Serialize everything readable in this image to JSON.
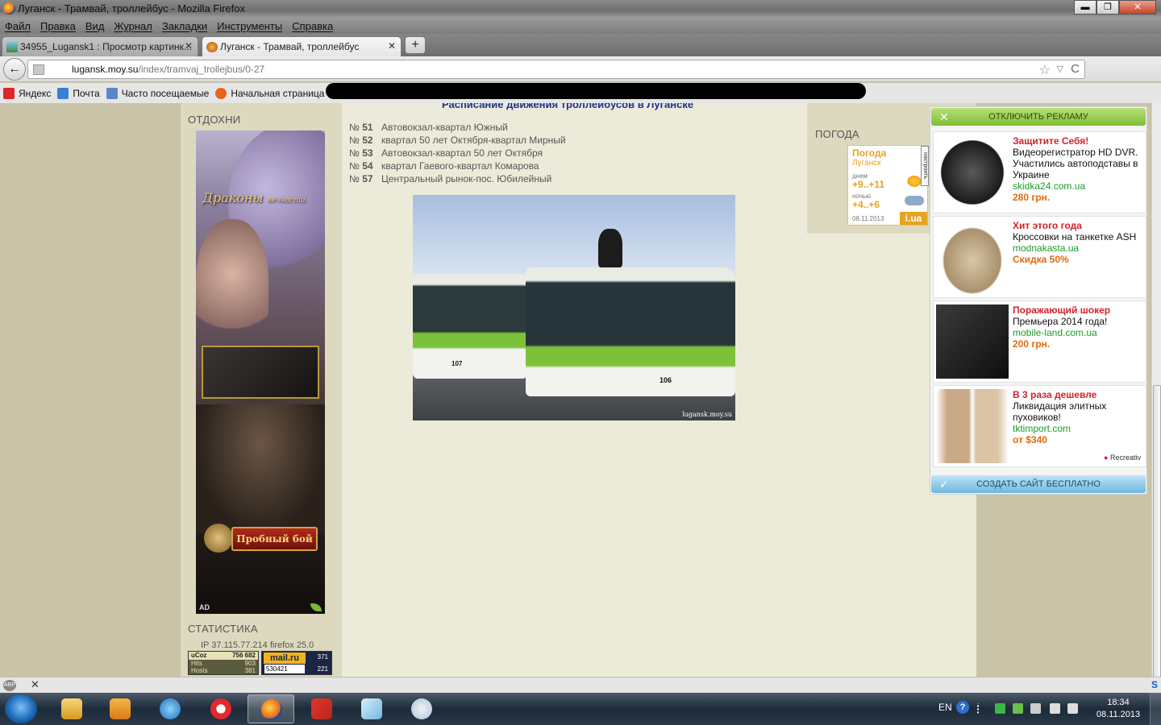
{
  "window": {
    "title": "Луганск - Трамвай, троллейбус - Mozilla Firefox",
    "btn_min": "▬",
    "btn_max": "❐",
    "btn_close": "✕"
  },
  "menu": [
    "Файл",
    "Правка",
    "Вид",
    "Журнал",
    "Закладки",
    "Инструменты",
    "Справка"
  ],
  "tabs": [
    {
      "label": "34955_Lugansk1 : Просмотр картинк...",
      "close": "✕"
    },
    {
      "label": "Луганск - Трамвай, троллейбус",
      "close": "✕"
    }
  ],
  "newtab_label": "+",
  "navbar": {
    "back": "←",
    "url_host": "lugansk.moy.su",
    "url_path": "/index/tramvaj_trollejbus/0-27",
    "star": "☆",
    "dropdown": "▽",
    "reload": "C",
    "download": "⬇",
    "ext": "S"
  },
  "bookmarks": [
    {
      "label": "Яндекс",
      "color": "#e0242a"
    },
    {
      "label": "Почта",
      "color": "#3a7fd3"
    },
    {
      "label": "Часто посещаемые",
      "color": "#5a86c8"
    },
    {
      "label": "Начальная страница",
      "color": "#e5651b"
    }
  ],
  "page": {
    "partial_title": "Расписание движения троллейбусов в Луганске",
    "left": {
      "section_relax": "ОТДОХНИ",
      "banner": {
        "logo": "Драконы",
        "logo_sub": "вечности",
        "try_button": "Пробный бой",
        "ad_mark": "AD"
      },
      "section_stats": "СТАТИСТИКА",
      "stats_ip": "IP 37.115.77.214 firefox 25.0",
      "counter1": {
        "top_left": "uCoz",
        "top_right": "756 682",
        "hits_label": "Hits",
        "hits": "903",
        "hosts_label": "Hosts",
        "hosts": "381"
      },
      "counter2": {
        "brand": "mail.ru",
        "v1": "371",
        "v2": "530421",
        "v3": "221"
      }
    },
    "routes": [
      {
        "prefix": "№",
        "num": "51",
        "name": "Автовокзал-квартал Южный"
      },
      {
        "prefix": "№",
        "num": "52",
        "name": "квартал 50 лет Октября-квартал Мирный"
      },
      {
        "prefix": "№",
        "num": "53",
        "name": "Автовокзал-квартал 50 лет Октября"
      },
      {
        "prefix": "№",
        "num": "54",
        "name": "квартал Гаевого-квартал Комарова"
      },
      {
        "prefix": "№",
        "num": "57",
        "name": "Центральный рынок-пос. Юбилейный"
      }
    ],
    "photo": {
      "watermark": "lugansk.moy.su",
      "bus1_num": "107",
      "bus2_num": "106"
    },
    "right": {
      "section_weather": "ПОГОДА",
      "weather": {
        "title": "Погода",
        "city": "Луганск",
        "day_label": "днем",
        "day_temp": "+9..+11",
        "night_label": "ночью",
        "night_temp": "+4..+6",
        "date": "08.11.2013",
        "brand": "i.ua",
        "side_label": "настроить"
      }
    }
  },
  "adpanel": {
    "disable_ads": "ОТКЛЮЧИТЬ РЕКЛАМУ",
    "create_site": "СОЗДАТЬ САЙТ БЕСПЛАТНО",
    "brand": "Recreativ",
    "items": [
      {
        "headline": "Защитите Себя!",
        "text": "Видеорегистратор HD DVR. Участились автоподставы в Украине",
        "link": "skidka24.com.ua",
        "price": "280 грн."
      },
      {
        "headline": "Хит этого года",
        "text": "Кроссовки на танкетке ASH",
        "link": "modnakasta.ua",
        "price": "Скидка 50%"
      },
      {
        "headline": "Поражающий шокер",
        "text": "Премьера 2014 года!",
        "link": "mobile-land.com.ua",
        "price": "200 грн."
      },
      {
        "headline": "В 3 раза дешевле",
        "text": "Ликвидация элитных пуховиков!",
        "link": "tktimport.com",
        "price": "от $340"
      }
    ]
  },
  "addonbar": {
    "abp": "ABP",
    "close": "✕"
  },
  "taskbar": {
    "lang": "EN",
    "help": "?",
    "time": "18:34",
    "date": "08.11.2013"
  }
}
